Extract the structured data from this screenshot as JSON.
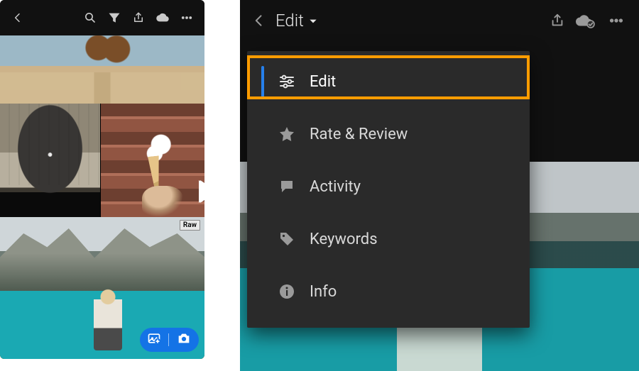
{
  "left": {
    "toolbar": {
      "back": "Back",
      "search": "Search",
      "filter": "Filter",
      "share": "Share",
      "cloud": "Cloud",
      "more": "More"
    },
    "raw_badge": "Raw",
    "fab": {
      "add_photos": "Add photos",
      "camera": "Camera"
    }
  },
  "right": {
    "title": "Edit",
    "toolbar": {
      "back": "Back",
      "share": "Share",
      "cloud_done": "Cloud synced",
      "more": "More"
    },
    "menu": {
      "edit": "Edit",
      "rate_review": "Rate & Review",
      "activity": "Activity",
      "keywords": "Keywords",
      "info": "Info"
    }
  }
}
